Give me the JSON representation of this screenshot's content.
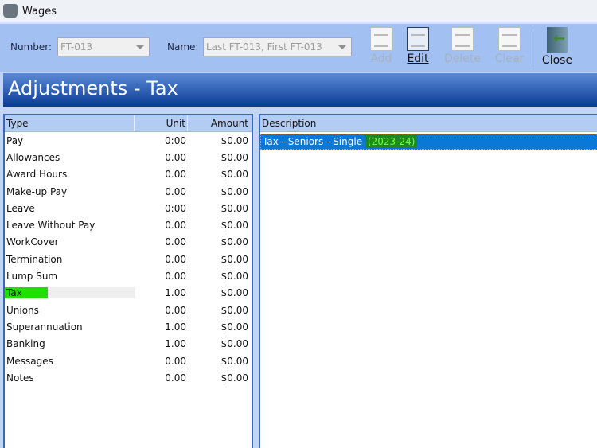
{
  "window": {
    "title": "Wages"
  },
  "toolbar": {
    "number_label": "Number:",
    "number_value": "FT-013",
    "name_label": "Name:",
    "name_value": "Last FT-013, First FT-013",
    "buttons": {
      "add": "Add",
      "edit": "Edit",
      "delete": "Delete",
      "clear": "Clear",
      "close": "Close"
    }
  },
  "banner": {
    "title": "Adjustments - Tax"
  },
  "types_table": {
    "headers": [
      "Type",
      "Unit",
      "Amount"
    ],
    "rows": [
      {
        "type": "Pay",
        "unit": "0:00",
        "amount": "$0.00"
      },
      {
        "type": "Allowances",
        "unit": "0.00",
        "amount": "$0.00"
      },
      {
        "type": "Award Hours",
        "unit": "0.00",
        "amount": "$0.00"
      },
      {
        "type": "Make-up Pay",
        "unit": "0.00",
        "amount": "$0.00"
      },
      {
        "type": "Leave",
        "unit": "0:00",
        "amount": "$0.00"
      },
      {
        "type": "Leave Without Pay",
        "unit": "0.00",
        "amount": "$0.00"
      },
      {
        "type": "WorkCover",
        "unit": "0.00",
        "amount": "$0.00"
      },
      {
        "type": "Termination",
        "unit": "0.00",
        "amount": "$0.00"
      },
      {
        "type": "Lump Sum",
        "unit": "0.00",
        "amount": "$0.00"
      },
      {
        "type": "Tax",
        "unit": "1.00",
        "amount": "$0.00"
      },
      {
        "type": "Unions",
        "unit": "0.00",
        "amount": "$0.00"
      },
      {
        "type": "Superannuation",
        "unit": "1.00",
        "amount": "$0.00"
      },
      {
        "type": "Banking",
        "unit": "1.00",
        "amount": "$0.00"
      },
      {
        "type": "Messages",
        "unit": "0.00",
        "amount": "$0.00"
      },
      {
        "type": "Notes",
        "unit": "0.00",
        "amount": "$0.00"
      }
    ],
    "selected_index": 9
  },
  "description_table": {
    "header": "Description",
    "rows": [
      {
        "text": "Tax - Seniors - Single",
        "year": "(2023-24)"
      }
    ]
  },
  "colors": {
    "highlight": "#21e000",
    "selection": "#0a78d7",
    "banner": "#0a3b94"
  }
}
